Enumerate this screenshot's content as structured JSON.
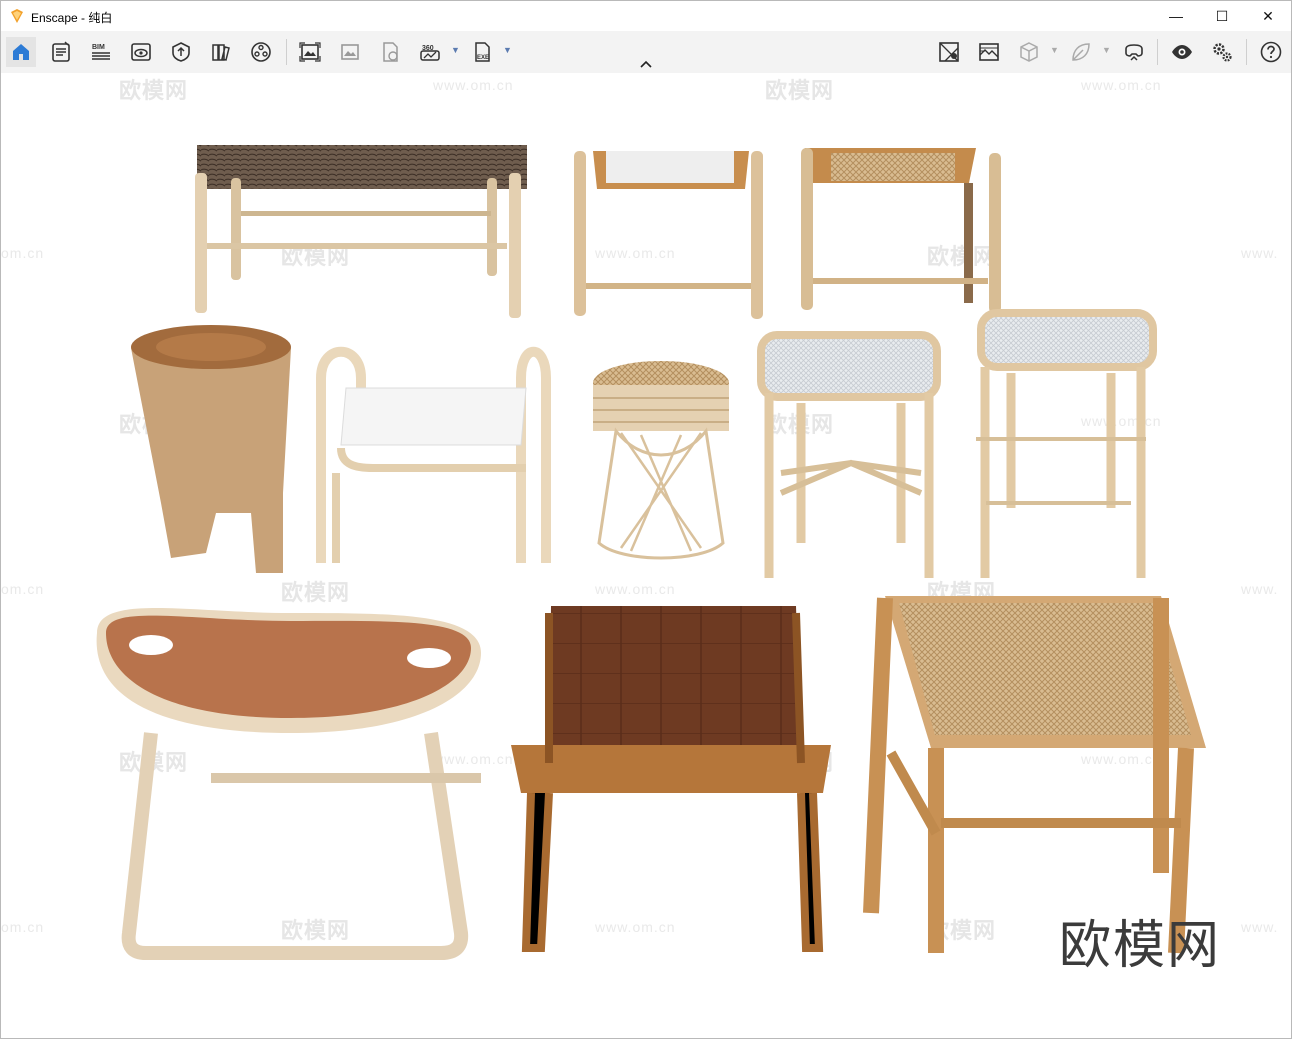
{
  "window": {
    "app_name": "Enscape",
    "title": "Enscape - 纯白",
    "minimize_glyph": "—",
    "maximize_glyph": "☐",
    "close_glyph": "✕"
  },
  "toolbar": {
    "left_icons": [
      "home-icon",
      "project-notes-icon",
      "bim-icon",
      "views-icon",
      "atmosphere-icon",
      "material-library-icon",
      "asset-library-icon",
      "screenshot-icon",
      "batch-render-icon",
      "upload-icon",
      "panorama-360-icon",
      "export-exe-icon"
    ],
    "bim_label": "BIM",
    "pano_label": "360",
    "exe_label": "EXE",
    "right_icons": [
      "visual-settings-icon",
      "sun-icon",
      "cube-icon",
      "leaf-icon",
      "vr-headset-icon",
      "eye-icon",
      "settings-gears-icon",
      "help-icon"
    ]
  },
  "watermarks": {
    "brand": "欧模网",
    "url": "www.om.cn",
    "url_partial": "om.cn",
    "url_partial_right": "www."
  },
  "colors": {
    "accent": "#2d7bd5",
    "toolbar_bg": "#f3f3f3",
    "viewport_bg": "#ffffff",
    "light_wood": "#e6d2b4",
    "leather_tan": "#b8734c",
    "leather_dark": "#6b3520",
    "teak": "#b5763a"
  }
}
